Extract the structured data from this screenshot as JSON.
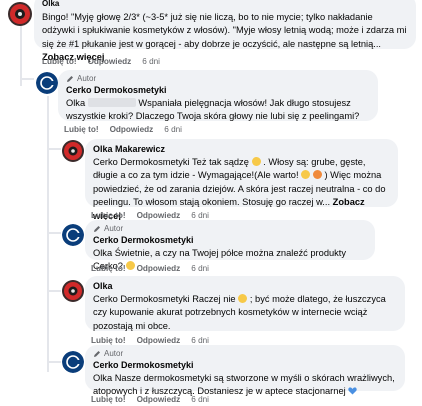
{
  "comments": [
    {
      "author": "Olka",
      "text": "Bingo! \"Myję głowę 2/3* (~3-5* już się nie liczą, bo to nie mycie; tylko nakładanie odżywki i spłukiwanie kosmetyków z włosów). \"Myje włosy letnią wodą; może i zdarza mi się że #1 płukanie jest w gorącej - aby dobrze je oczyścić, ale następne są letnią...",
      "more": "Zobacz więcej",
      "like": "Lubię to!",
      "reply": "Odpowiedz",
      "time": "6 dni"
    },
    {
      "role": "Autor",
      "author": "Cerko Dermokosmetyki",
      "name_prefix": "Olka",
      "text": "Wspaniała pielęgnacja włosów! Jak długo stosujesz wszystkie kroki? Dlaczego Twoja skóra głowy nie lubi się z peelingami?",
      "like": "Lubię to!",
      "reply": "Odpowiedz",
      "time": "6 dni"
    },
    {
      "author": "Olka Makarewicz",
      "text_a": "Cerko Dermokosmetyki Też tak sądzę",
      "text_b": ". Włosy są: grube, gęste, długie a co za tym idzie - Wymagające!(Ale warto!",
      "text_c": ") Więc można powiedzieć, że od zarania dziejów. A skóra jest raczej neutralna - co do peelingu. To włosom stają okoniem. Stosuję go raczej w...",
      "more": "Zobacz więcej",
      "like": "Lubię to!",
      "reply": "Odpowiedz",
      "time": "6 dni"
    },
    {
      "role": "Autor",
      "author": "Cerko Dermokosmetyki",
      "text": "Olka Świetnie, a czy na Twojej półce można znaleźć produkty Cerko?",
      "like": "Lubię to!",
      "reply": "Odpowiedz",
      "time": "6 dni"
    },
    {
      "author": "Olka",
      "text_a": "Cerko Dermokosmetyki Raczej nie",
      "text_b": "; być może dlatego, że łuszczyca czy kupowanie akurat potrzebnych kosmetyków w internecie wciąż pozostają mi obce.",
      "like": "Lubię to!",
      "reply": "Odpowiedz",
      "time": "6 dni"
    },
    {
      "role": "Autor",
      "author": "Cerko Dermokosmetyki",
      "text": "Olka Nasze dermokosmetyki są stworzone w myśli o skórach wrażliwych, atopowych i z łuszczycą. Dostaniesz je w aptece stacjonarnej",
      "like": "Lubię to!",
      "reply": "Odpowiedz",
      "time": "6 dni"
    }
  ],
  "icons": {
    "author_badge": "pencil-icon",
    "avatar_cerko": "cerko-logo-icon",
    "avatar_olka": "user-photo-icon",
    "heart": "blue-heart-icon"
  },
  "colors": {
    "bubble": "#f0f2f5",
    "meta": "#65676b",
    "cerko_avatar": "#0a3d7a"
  }
}
